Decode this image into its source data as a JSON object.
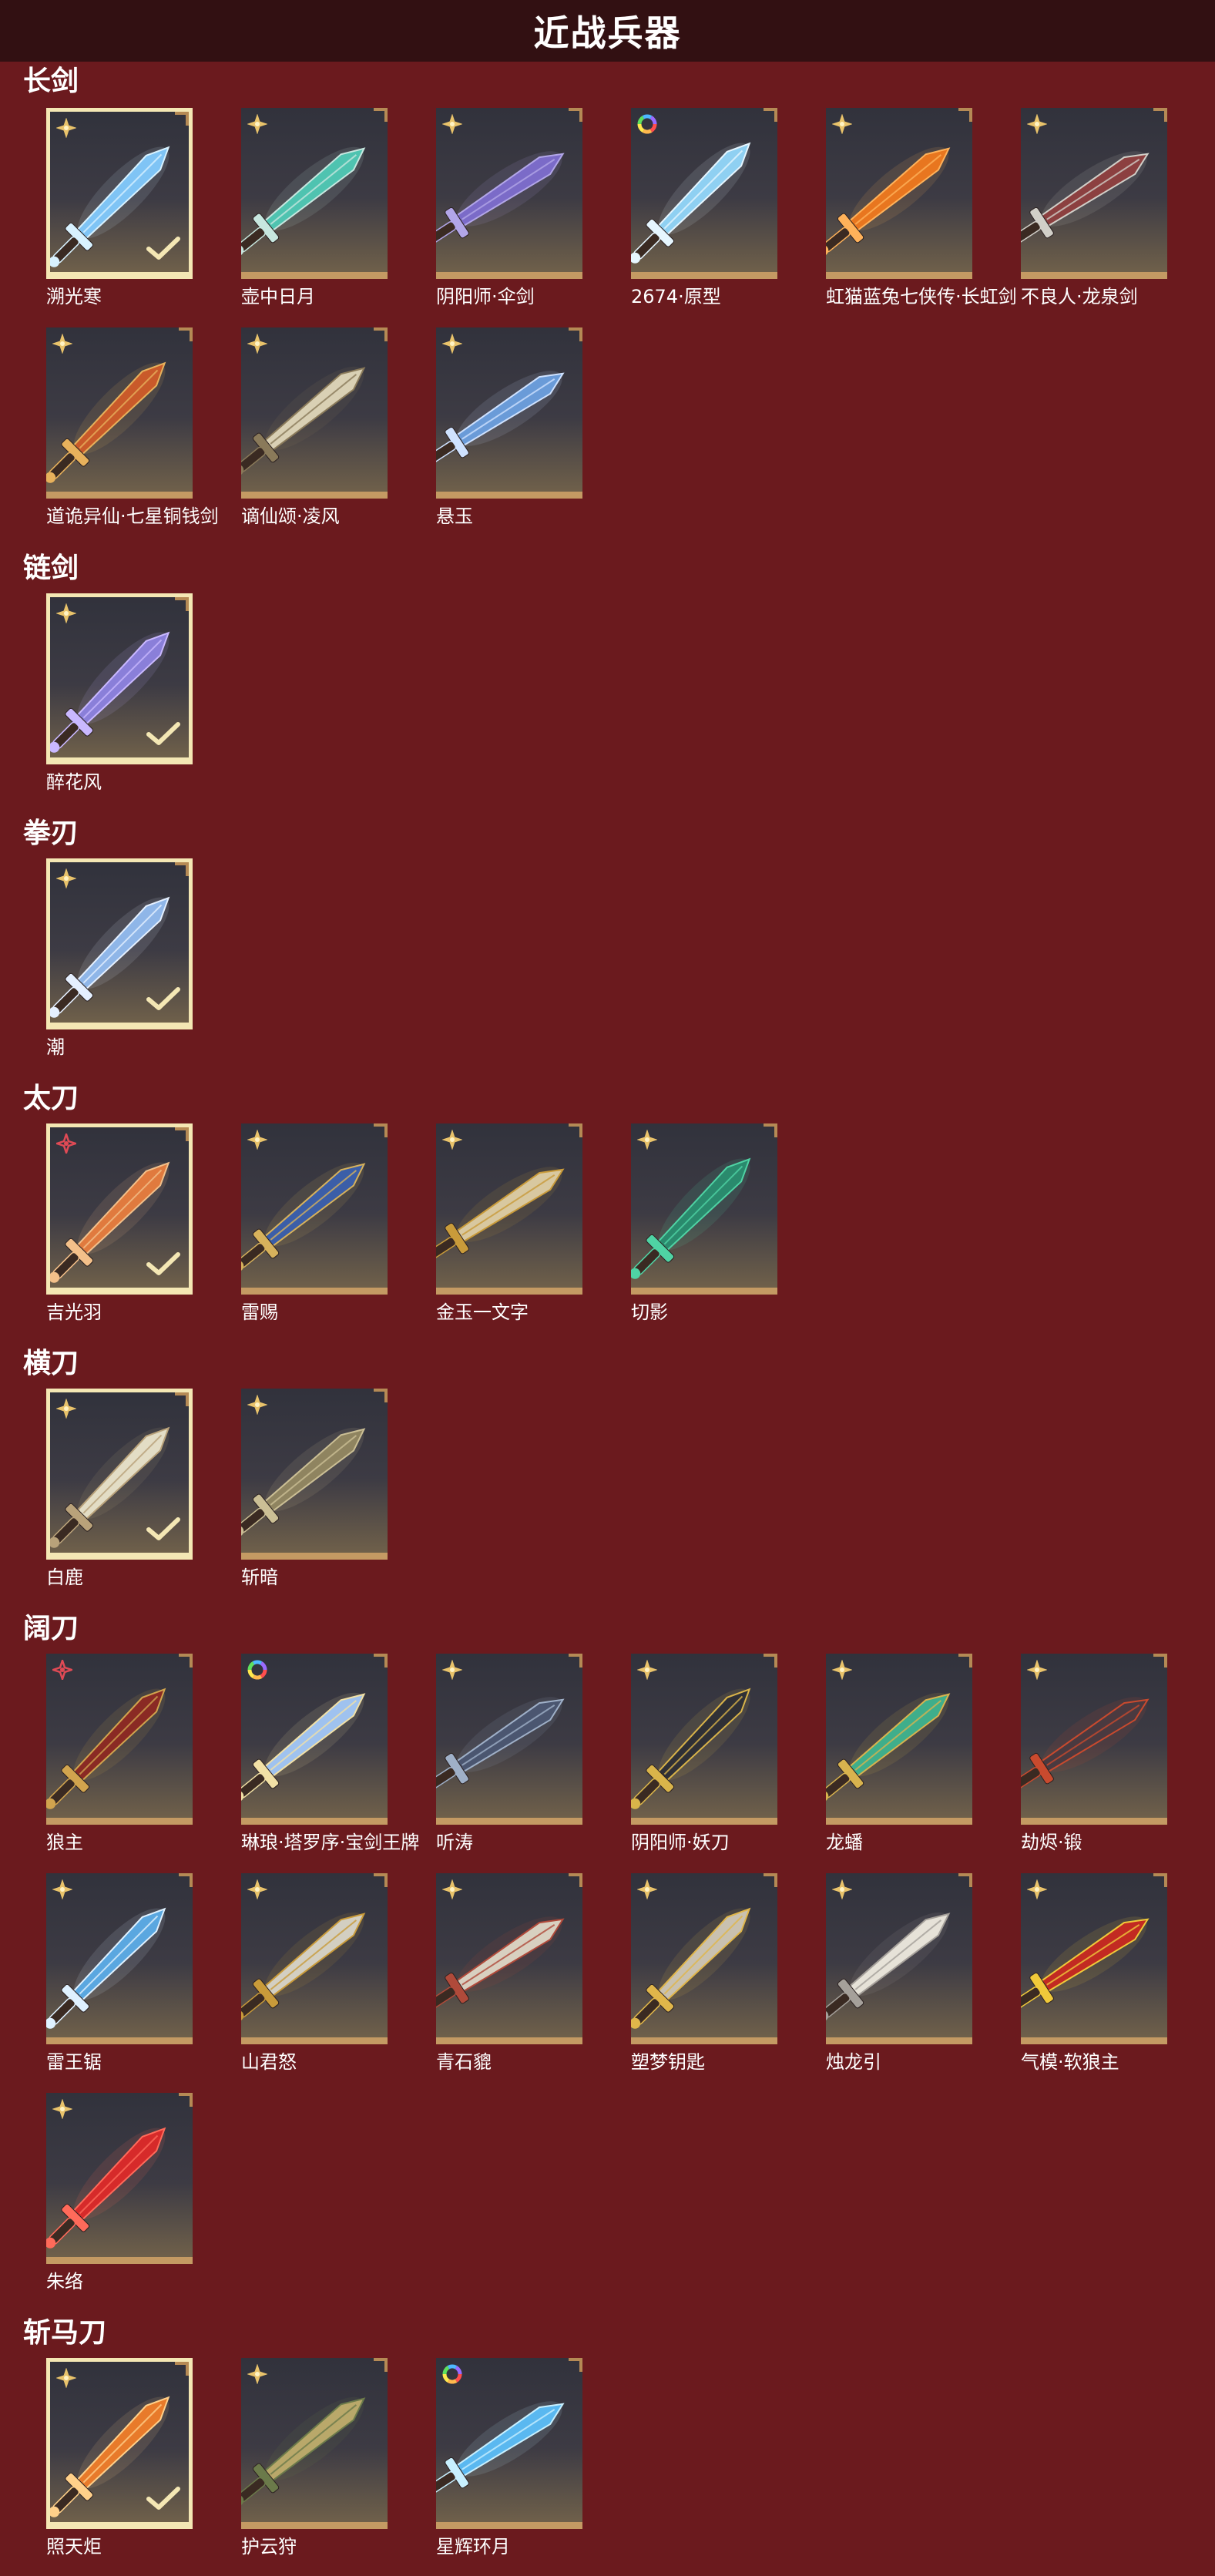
{
  "page": {
    "title": "近战兵器"
  },
  "theme": {
    "background": "#6b1a1e",
    "header": "#321012",
    "card_border": "#c49a63",
    "selected_border": "#f4e7b4",
    "rarity_gold": "#e9c36b",
    "rarity_red": "#e04a55"
  },
  "categories": [
    {
      "name": "长剑",
      "rows": [
        [
          {
            "name": "溯光寒",
            "rarity": "gold",
            "selected": true,
            "blade": "#7fc4f5",
            "accent": "#d8f2ff"
          },
          {
            "name": "壶中日月",
            "rarity": "gold",
            "selected": false,
            "blade": "#4fc3b0",
            "accent": "#c7e7df"
          },
          {
            "name": "阴阳师·伞剑",
            "rarity": "gold",
            "selected": false,
            "blade": "#7b6bc8",
            "accent": "#b2a6e8"
          },
          {
            "name": "2674·原型",
            "rarity": "rainbow",
            "selected": false,
            "blade": "#8fd0f2",
            "accent": "#e6f6ff"
          },
          {
            "name": "虹猫蓝兔七侠传·长虹剑",
            "rarity": "gold",
            "selected": false,
            "blade": "#e8761f",
            "accent": "#ffb25a"
          },
          {
            "name": "不良人·龙泉剑",
            "rarity": "gold",
            "selected": false,
            "blade": "#8c4040",
            "accent": "#d1cfc8"
          }
        ],
        [
          {
            "name": "道诡异仙·七星铜钱剑",
            "rarity": "gold",
            "selected": false,
            "blade": "#c95a2a",
            "accent": "#e7b15c"
          },
          {
            "name": "谪仙颂·凌风",
            "rarity": "gold",
            "selected": false,
            "blade": "#d9d0b4",
            "accent": "#8a7a5a"
          },
          {
            "name": "悬玉",
            "rarity": "gold",
            "selected": false,
            "blade": "#6a9bd8",
            "accent": "#cfe2ff"
          }
        ]
      ]
    },
    {
      "name": "链剑",
      "rows": [
        [
          {
            "name": "醉花风",
            "rarity": "gold",
            "selected": true,
            "blade": "#8a7fd9",
            "accent": "#c9b8ff"
          }
        ]
      ]
    },
    {
      "name": "拳刃",
      "rows": [
        [
          {
            "name": "潮",
            "rarity": "gold",
            "selected": true,
            "blade": "#8fb6e8",
            "accent": "#e5f0ff"
          }
        ]
      ]
    },
    {
      "name": "太刀",
      "rows": [
        [
          {
            "name": "吉光羽",
            "rarity": "red",
            "selected": true,
            "blade": "#e07a3e",
            "accent": "#f3c08a"
          },
          {
            "name": "雷赐",
            "rarity": "gold",
            "selected": false,
            "blade": "#3b5ea8",
            "accent": "#d7b25c"
          },
          {
            "name": "金玉一文字",
            "rarity": "gold",
            "selected": false,
            "blade": "#d8c8a0",
            "accent": "#c99b3a"
          },
          {
            "name": "切影",
            "rarity": "gold",
            "selected": false,
            "blade": "#2a8a6d",
            "accent": "#4fd3a4"
          }
        ]
      ]
    },
    {
      "name": "横刀",
      "rows": [
        [
          {
            "name": "白鹿",
            "rarity": "gold",
            "selected": true,
            "blade": "#e3ddc5",
            "accent": "#b9a27a"
          },
          {
            "name": "斩暗",
            "rarity": "gold",
            "selected": false,
            "blade": "#8f8460",
            "accent": "#cbbf95"
          }
        ]
      ]
    },
    {
      "name": "阔刀",
      "rows": [
        [
          {
            "name": "狼主",
            "rarity": "red",
            "selected": false,
            "blade": "#8a2a24",
            "accent": "#d1a44e"
          },
          {
            "name": "琳琅·塔罗序·宝剑王牌",
            "rarity": "rainbow",
            "selected": false,
            "blade": "#9fc2ef",
            "accent": "#f2e1a6"
          },
          {
            "name": "听涛",
            "rarity": "gold",
            "selected": false,
            "blade": "#4b5670",
            "accent": "#9fb0c8"
          },
          {
            "name": "阴阳师·妖刀",
            "rarity": "gold",
            "selected": false,
            "blade": "#2f3036",
            "accent": "#d9b44a"
          },
          {
            "name": "龙蟠",
            "rarity": "gold",
            "selected": false,
            "blade": "#3fae8b",
            "accent": "#d8b34e"
          },
          {
            "name": "劫烬·锻",
            "rarity": "gold",
            "selected": false,
            "blade": "#4a3a40",
            "accent": "#c94a2e"
          }
        ],
        [
          {
            "name": "雷王锯",
            "rarity": "gold",
            "selected": false,
            "blade": "#5aa7e0",
            "accent": "#dff1ff"
          },
          {
            "name": "山君怒",
            "rarity": "gold",
            "selected": false,
            "blade": "#d3cfc2",
            "accent": "#c99b3a"
          },
          {
            "name": "青石貔",
            "rarity": "gold",
            "selected": false,
            "blade": "#d8d0c0",
            "accent": "#b04a3a"
          },
          {
            "name": "塑梦钥匙",
            "rarity": "gold",
            "selected": false,
            "blade": "#c9c1b0",
            "accent": "#e0b64a"
          },
          {
            "name": "烛龙引",
            "rarity": "gold",
            "selected": false,
            "blade": "#e6e2d8",
            "accent": "#a5a09a"
          },
          {
            "name": "气模·软狼主",
            "rarity": "gold",
            "selected": false,
            "blade": "#c22a22",
            "accent": "#f0c93a"
          }
        ],
        [
          {
            "name": "朱络",
            "rarity": "gold",
            "selected": false,
            "blade": "#d62a2a",
            "accent": "#ff6a5a"
          }
        ]
      ]
    },
    {
      "name": "斩马刀",
      "rows": [
        [
          {
            "name": "照天炬",
            "rarity": "gold",
            "selected": true,
            "blade": "#e87a2a",
            "accent": "#ffd08a"
          },
          {
            "name": "护云狩",
            "rarity": "gold",
            "selected": false,
            "blade": "#b9a86a",
            "accent": "#6b7a4a"
          },
          {
            "name": "星辉环月",
            "rarity": "rainbow",
            "selected": false,
            "blade": "#5ab8f0",
            "accent": "#c8f0ff"
          }
        ]
      ]
    }
  ]
}
